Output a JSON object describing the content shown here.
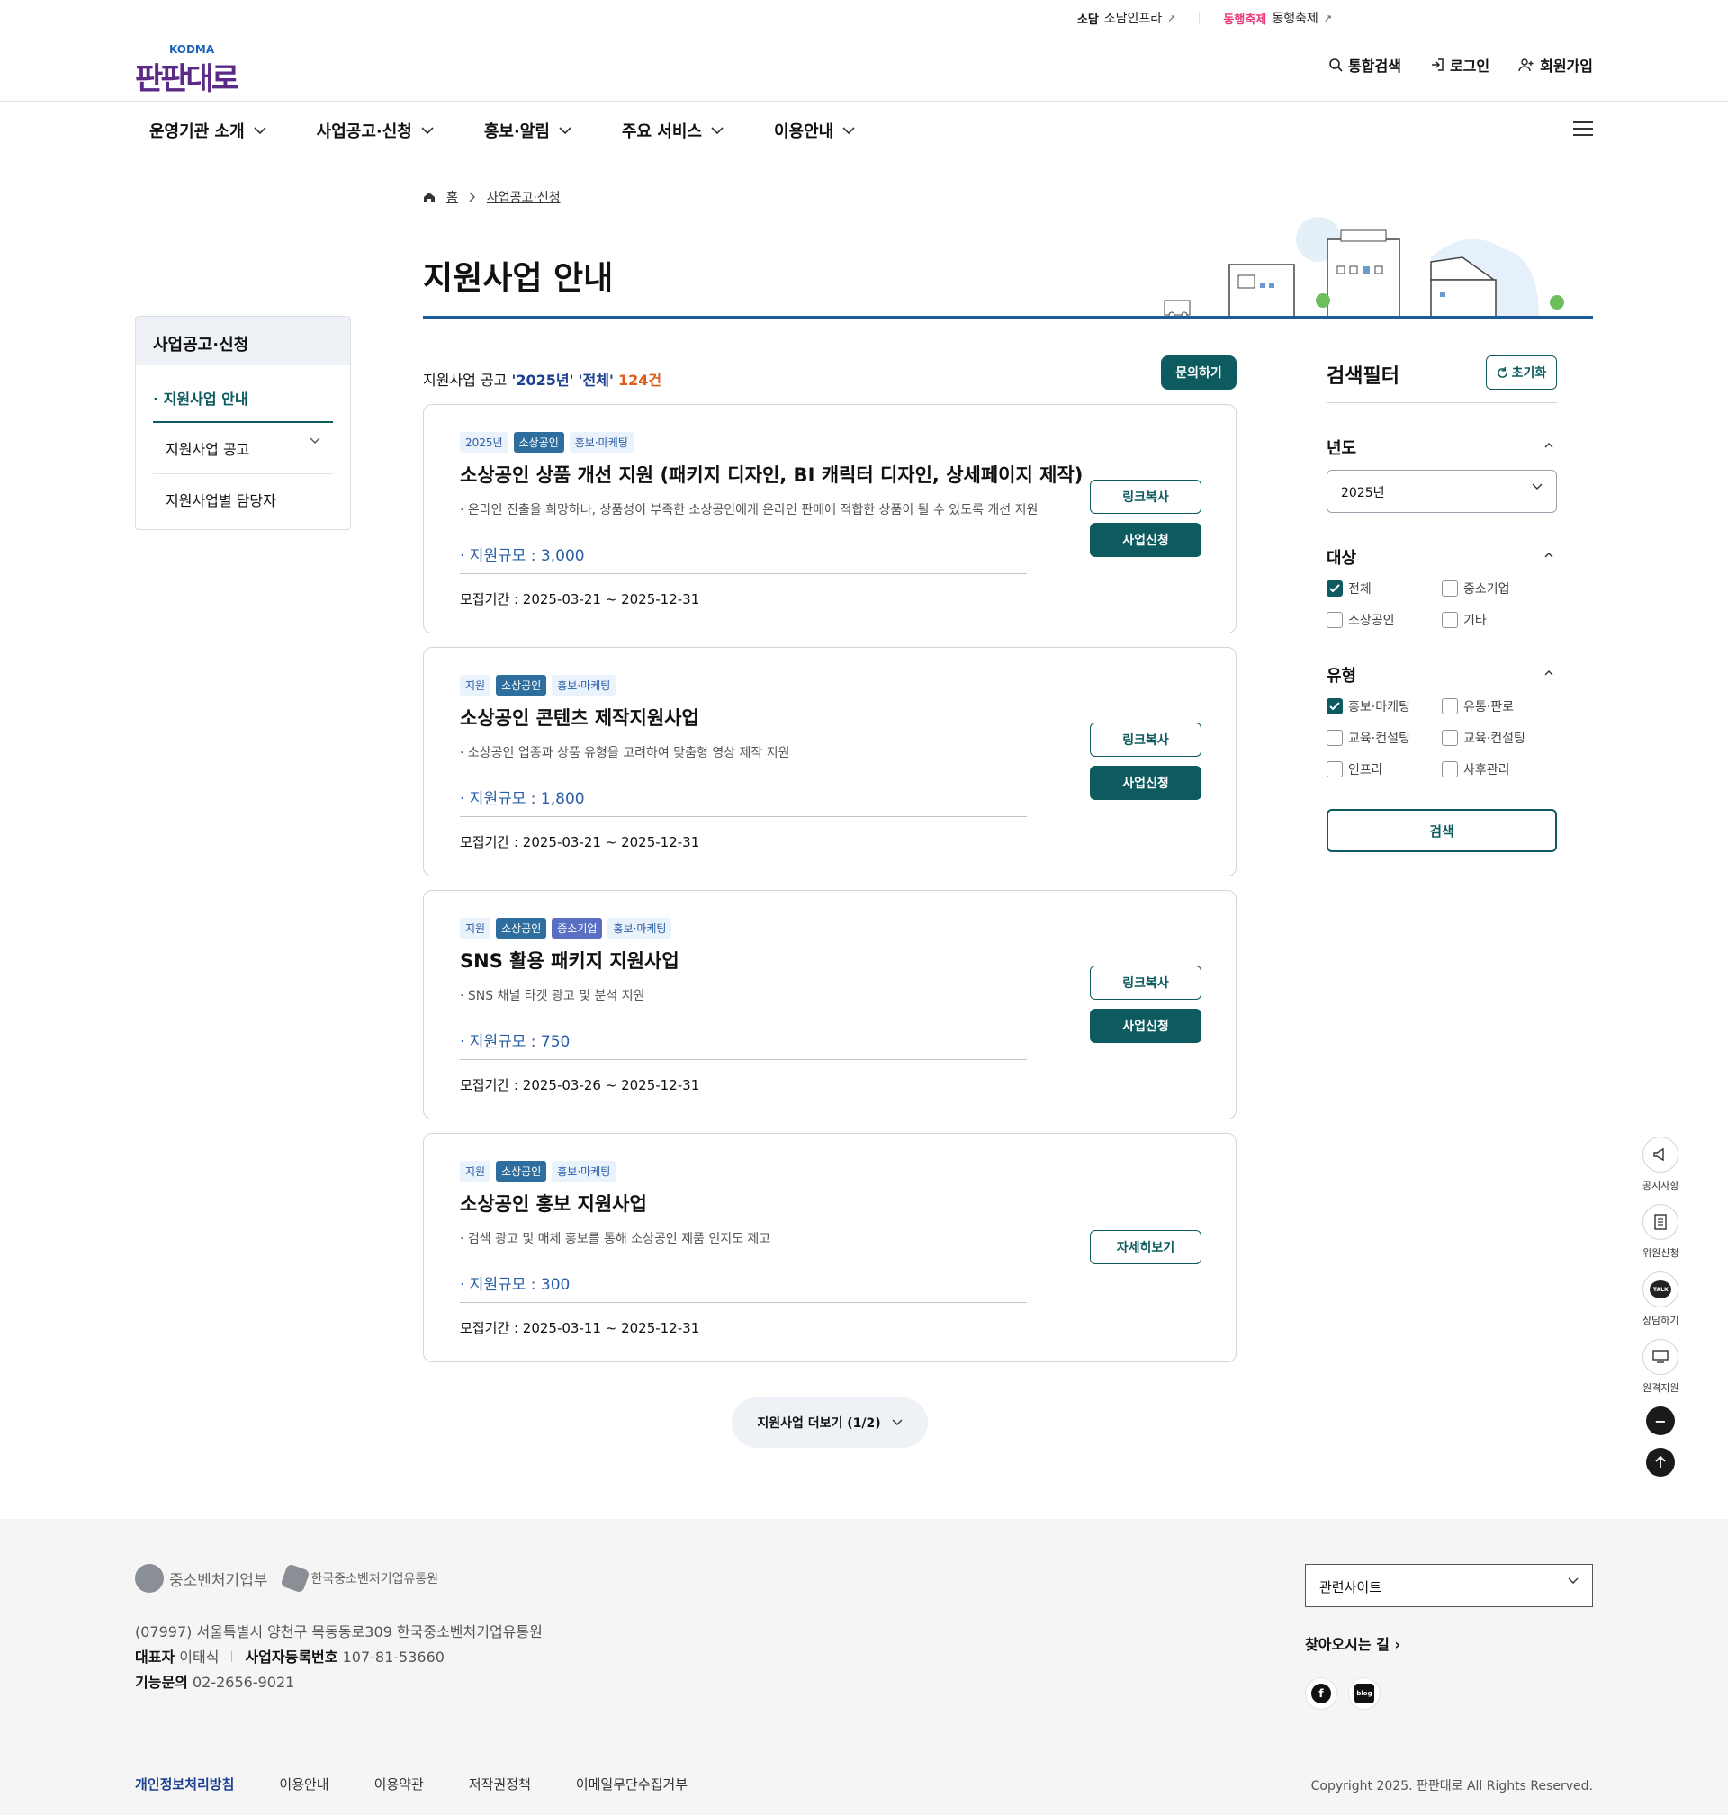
{
  "util": {
    "s_logo": "소담",
    "s_label": "소담인프라",
    "d_logo": "동행축제",
    "d_label": "동행축제"
  },
  "logo": {
    "small": "KODMA",
    "brand": "판판대로"
  },
  "topnav": {
    "search": "통합검색",
    "login": "로그인",
    "join": "회원가입"
  },
  "gnb": [
    "운영기관 소개",
    "사업공고·신청",
    "홍보·알림",
    "주요 서비스",
    "이용안내"
  ],
  "lnb": {
    "title": "사업공고·신청",
    "items": [
      "지원사업 안내",
      "지원사업 공고",
      "지원사업별 담당자"
    ]
  },
  "breadcrumb": {
    "home": "홈",
    "current": "사업공고·신청"
  },
  "page_title": "지원사업 안내",
  "count": {
    "prefix": "지원사업 공고",
    "year": "'2025년'",
    "scope": "'전체'",
    "total": "124건"
  },
  "inquiry_label": "문의하기",
  "cards": [
    {
      "tags": [
        "2025년",
        "소상공인",
        "홍보·마케팅"
      ],
      "title": "소상공인 상품 개선 지원 (패키지 디자인, BI 캐릭터 디자인, 상세페이지 제작)",
      "desc": "· 온라인 진출을 희망하나, 상품성이 부족한 소상공인에게 온라인 판매에 적합한 상품이 될 수 있도록 개선 지원",
      "scale": "· 지원규모 : 3,000",
      "period": "모집기간 : 2025-03-21 ~ 2025-12-31",
      "btn1": "링크복사",
      "btn2": "사업신청"
    },
    {
      "tags": [
        "지원",
        "소상공인",
        "홍보·마케팅"
      ],
      "title": "소상공인 콘텐츠 제작지원사업",
      "desc": "· 소상공인 업종과 상품 유형을 고려하여 맞춤형 영상 제작 지원",
      "scale": "· 지원규모 : 1,800",
      "period": "모집기간 : 2025-03-21 ~ 2025-12-31",
      "btn1": "링크복사",
      "btn2": "사업신청"
    },
    {
      "tags": [
        "지원",
        "소상공인",
        "중소기업",
        "홍보·마케팅"
      ],
      "title": "SNS 활용 패키지 지원사업",
      "desc": "· SNS 채널 타겟 광고 및 분석 지원",
      "scale": "· 지원규모 : 750",
      "period": "모집기간 : 2025-03-26 ~ 2025-12-31",
      "btn1": "링크복사",
      "btn2": "사업신청"
    },
    {
      "tags": [
        "지원",
        "소상공인",
        "홍보·마케팅"
      ],
      "title": "소상공인 홍보 지원사업",
      "desc": "· 검색 광고 및 매체 홍보를 통해 소상공인 제품 인지도 제고",
      "scale": "· 지원규모 : 300",
      "period": "모집기간 : 2025-03-11 ~ 2025-12-31",
      "btn1": "자세히보기"
    }
  ],
  "more_label": "지원사업 더보기 (1/2)",
  "filter": {
    "title": "검색필터",
    "reset": "초기화",
    "year_label": "년도",
    "year_value": "2025년",
    "target_label": "대상",
    "targets": [
      "전체",
      "중소기업",
      "소상공인",
      "기타"
    ],
    "type_label": "유형",
    "types": [
      "홍보·마케팅",
      "유통·판로",
      "교육·컨설팅",
      "교육·컨설팅",
      "인프라",
      "사후관리"
    ],
    "search": "검색"
  },
  "quick": [
    "공지사항",
    "위원신청",
    "상담하기",
    "원격지원"
  ],
  "quick_talk": "TALK",
  "footer": {
    "org1": "중소벤처기업부",
    "org2": "한국중소벤처기업유통원",
    "address": "(07997) 서울특별시 양천구 목동동로309 한국중소벤처기업유통원",
    "ceo_label": "대표자",
    "ceo": "이태식",
    "biz_label": "사업자등록번호",
    "biz": "107-81-53660",
    "tel_label": "기능문의",
    "tel": "02-2656-9021",
    "related": "관련사이트",
    "way": "찾아오시는 길",
    "sns1": "f",
    "sns2": "blog",
    "links": [
      "개인정보처리방침",
      "이용안내",
      "이용약관",
      "저작권정책",
      "이메일무단수집거부"
    ],
    "copyright": "Copyright 2025. 판판대로 All Rights Reserved."
  },
  "colors": {
    "primary": "#0d5b5f",
    "navy": "#1d3f8f",
    "accent": "#e05a1c",
    "brand": "#5b2a86"
  }
}
